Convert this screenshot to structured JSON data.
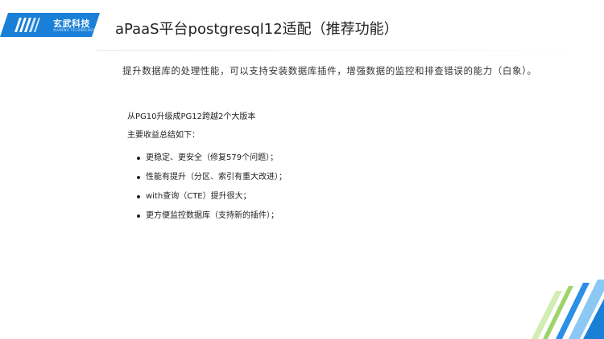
{
  "header": {
    "logo_text": "玄武科技",
    "logo_subtext": "XUANWU TECHNOLOGY",
    "title": "aPaaS平台postgresql12适配（推荐功能）"
  },
  "subtitle": "提升数据库的处理性能，可以支持安装数据库插件，增强数据的监控和排查错误的能力（白象）。",
  "content": {
    "intro_lines": [
      "从PG10升级成PG12跨越2个大版本",
      "主要收益总结如下："
    ],
    "bullets": [
      "更稳定、更安全（修复579个问题）；",
      "性能有提升（分区、索引有重大改进）；",
      "with查询（CTE）提升很大；",
      "更方便监控数据库（支持新的插件）；"
    ]
  },
  "colors": {
    "brand_blue": "#1a7fd6",
    "accent_green": "#9ed36a",
    "accent_blue": "#2a8fe6"
  },
  "icons": {
    "logo": "xw-logo-mark",
    "decoration": "corner-stripes"
  }
}
